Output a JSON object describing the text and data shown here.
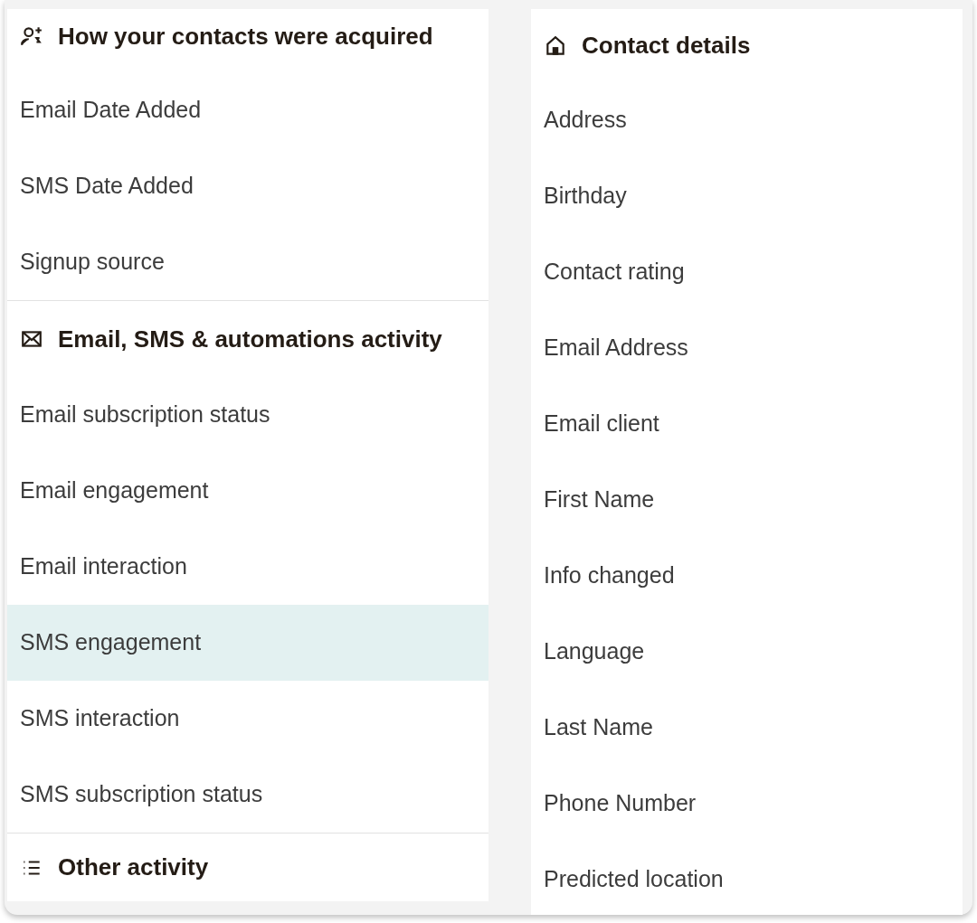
{
  "left_panel": {
    "sections": [
      {
        "kind": "acquisition",
        "title": "How your contacts were acquired",
        "items": [
          {
            "label": "Email Date Added",
            "selected": false
          },
          {
            "label": "SMS Date Added",
            "selected": false
          },
          {
            "label": "Signup source",
            "selected": false
          }
        ]
      },
      {
        "kind": "messaging",
        "title": "Email, SMS & automations activity",
        "items": [
          {
            "label": "Email subscription status",
            "selected": false
          },
          {
            "label": "Email engagement",
            "selected": false
          },
          {
            "label": "Email interaction",
            "selected": false
          },
          {
            "label": "SMS engagement",
            "selected": true
          },
          {
            "label": "SMS interaction",
            "selected": false
          },
          {
            "label": "SMS subscription status",
            "selected": false
          }
        ]
      },
      {
        "kind": "other",
        "title": "Other activity"
      }
    ]
  },
  "right_panel": {
    "sections": [
      {
        "kind": "details",
        "title": "Contact details",
        "items": [
          {
            "label": "Address",
            "selected": false
          },
          {
            "label": "Birthday",
            "selected": false
          },
          {
            "label": "Contact rating",
            "selected": false
          },
          {
            "label": "Email Address",
            "selected": false
          },
          {
            "label": "Email client",
            "selected": false
          },
          {
            "label": "First Name",
            "selected": false
          },
          {
            "label": "Info changed",
            "selected": false
          },
          {
            "label": "Language",
            "selected": false
          },
          {
            "label": "Last Name",
            "selected": false
          },
          {
            "label": "Phone Number",
            "selected": false
          },
          {
            "label": "Predicted location",
            "selected": false
          }
        ]
      }
    ]
  }
}
